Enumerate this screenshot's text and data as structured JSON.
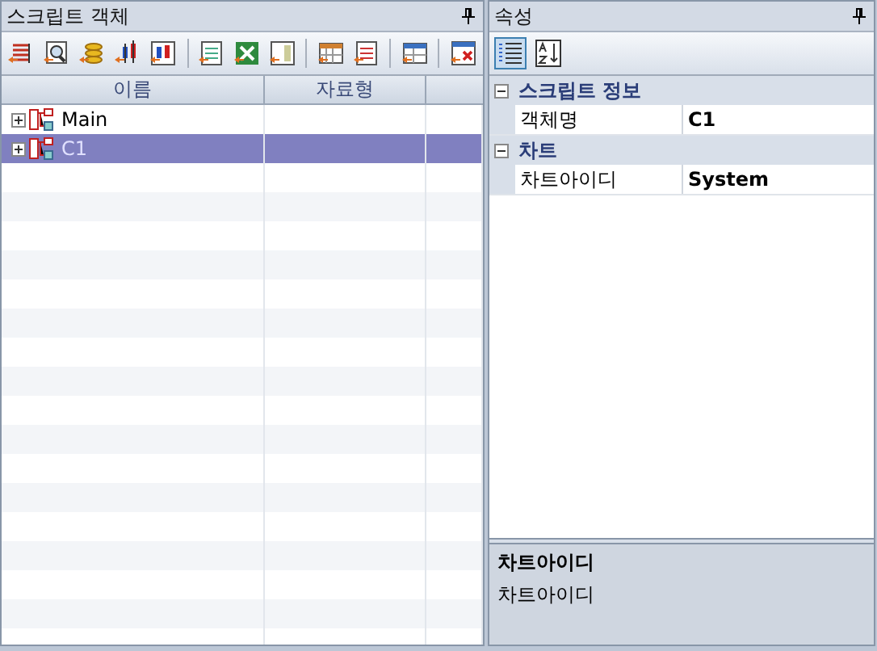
{
  "left_panel": {
    "title": "스크립트 객체",
    "columns": [
      "이름",
      "자료형"
    ],
    "rows": [
      {
        "name": "Main",
        "selected": false
      },
      {
        "name": "C1",
        "selected": true
      }
    ]
  },
  "right_panel": {
    "title": "속성",
    "view_buttons": [
      {
        "kind": "categorized",
        "selected": true
      },
      {
        "kind": "alphabetical",
        "selected": false
      }
    ],
    "categories": [
      {
        "name": "스크립트 정보",
        "expanded": true,
        "properties": [
          {
            "name": "객체명",
            "value": "C1"
          }
        ]
      },
      {
        "name": "차트",
        "expanded": true,
        "properties": [
          {
            "name": "차트아이디",
            "value": "System"
          }
        ]
      }
    ],
    "description": {
      "title": "차트아이디",
      "text": "차트아이디"
    }
  }
}
